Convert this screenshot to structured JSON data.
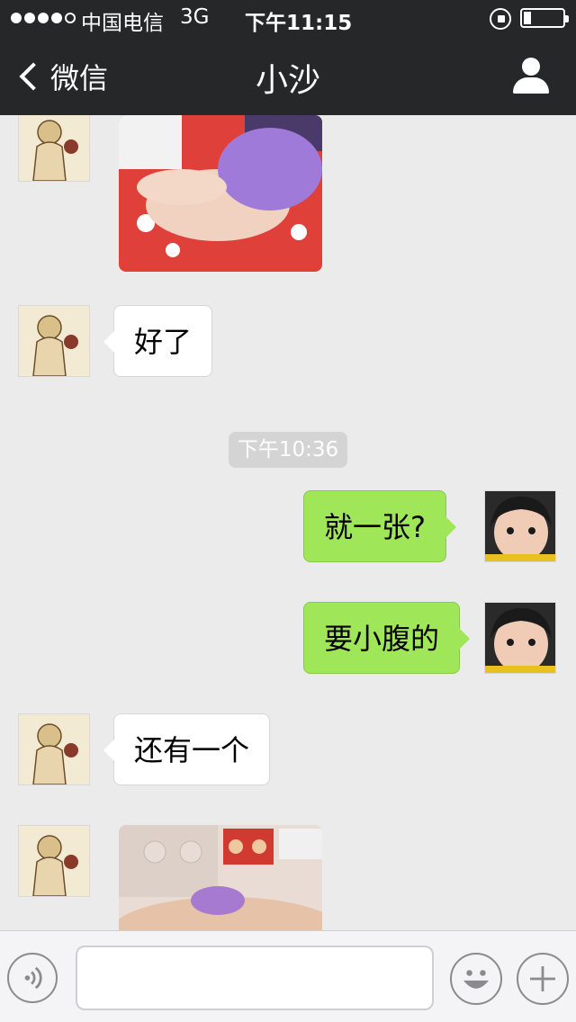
{
  "status_bar": {
    "carrier": "中国电信",
    "network": "3G",
    "time": "下午11:15",
    "signal_bars_filled": 4,
    "signal_bars_total": 5,
    "battery_level": 0.2
  },
  "nav": {
    "back_label": "微信",
    "title": "小沙"
  },
  "messages": {
    "m1_text": "好了",
    "timestamp": "下午10:36",
    "m2_text": "就一张?",
    "m3_text": "要小腹的",
    "m4_text": "还有一个"
  },
  "colors": {
    "nav_background": "#262728",
    "chat_background": "#ebebeb",
    "outgoing_bubble": "#9fe658",
    "incoming_bubble": "#ffffff"
  },
  "icons": {
    "back": "chevron-left-icon",
    "profile": "person-icon",
    "voice": "voice-icon",
    "emoji": "smiley-icon",
    "add": "plus-icon"
  }
}
